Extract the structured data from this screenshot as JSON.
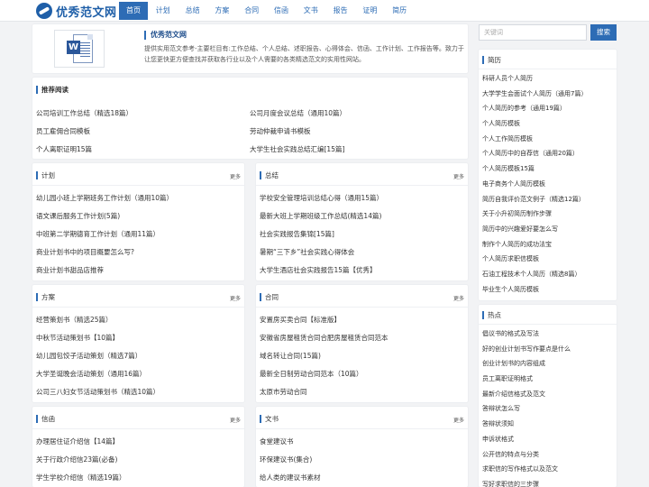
{
  "site": {
    "logo_text": "优秀范文网"
  },
  "nav": [
    {
      "label": "首页",
      "active": true
    },
    {
      "label": "计划"
    },
    {
      "label": "总结"
    },
    {
      "label": "方案"
    },
    {
      "label": "合同"
    },
    {
      "label": "信函"
    },
    {
      "label": "文书"
    },
    {
      "label": "报告"
    },
    {
      "label": "证明"
    },
    {
      "label": "简历"
    }
  ],
  "intro": {
    "icon": "word-document-icon",
    "title": "优秀范文网",
    "desc": "提供实用范文参考-主要栏目有:工作总结、个人总结、述职报告、心得体会、信函、工作计划、工作报告等。致力于让您更快更方便查找并获取各行业以及个人需要的各类精选范文的实用性网站。"
  },
  "recommend": {
    "title": "推荐阅读",
    "items": [
      "公司培训工作总结（精选18篇）",
      "公司月度会议总结（通用10篇）",
      "员工雇佣合同模板",
      "劳动仲裁申请书模板",
      "个人离职证明15篇",
      "大学生社会实践总结汇编[15篇]"
    ]
  },
  "more_label": "更多",
  "sections": {
    "plan": {
      "title": "计划",
      "items": [
        "幼儿园小班上学期班务工作计划（通用10篇）",
        "语文课后服务工作计划(5篇)",
        "中班第二学期德育工作计划（通用11篇）",
        "商业计划书中的项目概要怎么写?",
        "商业计划书甜品店推荐"
      ]
    },
    "summary": {
      "title": "总结",
      "items": [
        "学校安全管理培训总结心得（通用15篇）",
        "最新大班上学期班级工作总结(精选14篇)",
        "社会实践报告集锦[15篇]",
        "暑期“三下乡”社会实践心得体会",
        "大学生酒店社会实践报告15篇【优秀】"
      ]
    },
    "scheme": {
      "title": "方案",
      "items": [
        "经营策划书（精选25篇）",
        "中秋节活动策划书【10篇】",
        "幼儿园包饺子活动策划（精选7篇）",
        "大学圣诞晚会活动策划（通用16篇）",
        "公司三八妇女节活动策划书（精选10篇）"
      ]
    },
    "contract": {
      "title": "合同",
      "items": [
        "安置房买卖合同【标准版】",
        "安徽省房屋租赁合同合肥房屋租赁合同范本",
        "域名转让合同(15篇)",
        "最新全日制劳动合同范本（10篇）",
        "太原市劳动合同"
      ]
    },
    "letter": {
      "title": "信函",
      "items": [
        "办理居住证介绍信【14篇】",
        "关于行政介绍信23篇(必备)",
        "学生学校介绍信（精选19篇）"
      ]
    },
    "document": {
      "title": "文书",
      "items": [
        "食堂建议书",
        "环保建议书(集合)",
        "给人类的建议书素材"
      ]
    }
  },
  "search": {
    "placeholder": "关键词",
    "button_label": "搜索"
  },
  "sidebar": {
    "resume": {
      "title": "简历",
      "items": [
        "科研人员个人简历",
        "大学学生会面试个人简历（通用7篇）",
        "个人简历的参考（通用19篇）",
        "个人简历模板",
        "个人工作简历模板",
        "个人简历中的自荐信（通用20篇）",
        "个人简历模板15篇",
        "电子商务个人简历模板",
        "简历自我评价范文例子（精选12篇）",
        "关于小升初简历制作步骤",
        "简历中的兴趣爱好要怎么写",
        "制作个人简历的成功法宝",
        "个人简历求职信模板",
        "石油工程技术个人简历（精选8篇）",
        "毕业生个人简历模板"
      ]
    },
    "hot": {
      "title": "热点",
      "items": [
        "倡议书的格式及写法",
        "好的创业计划书写作要点是什么",
        "创业计划书的内容组成",
        "员工离职证明格式",
        "最新介绍信格式及范文",
        "答辩状怎么写",
        "答辩状须知",
        "申诉状格式",
        "公开信的特点与分类",
        "求职信的写作格式以及范文",
        "写好求职信的三步骤"
      ]
    }
  }
}
